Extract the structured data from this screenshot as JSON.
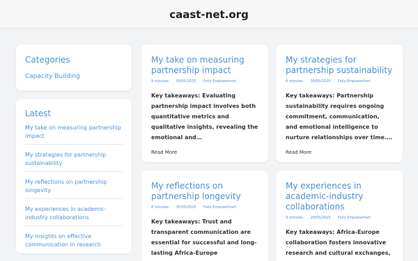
{
  "site": {
    "title": "caast-net.org"
  },
  "sidebar": {
    "categories_title": "Categories",
    "categories": [
      "Capacity Building"
    ],
    "latest_title": "Latest",
    "latest": [
      "My take on measuring partnership impact",
      "My strategies for partnership sustainability",
      "My reflections on partnership longevity",
      "My experiences in academic-industry collaborations",
      "My insights on effective communication in research"
    ]
  },
  "posts": [
    {
      "title": "My take on measuring partnership impact",
      "read_time": "9 minutes",
      "date": "30/05/2025",
      "author": "Felix Empowerhart",
      "excerpt": "Key takeaways: Evaluating partnership impact involves both quantitative metrics and qualitative insights, revealing the emotional and…",
      "read_more": "Read More"
    },
    {
      "title": "My strategies for partnership sustainability",
      "read_time": "8 minutes",
      "date": "30/05/2025",
      "author": "Felix Empowerhart",
      "excerpt": "Key takeaways: Partnership sustainability requires ongoing commitment, communication, and emotional intelligence to nurture relationships over time.…",
      "read_more": "Read More"
    },
    {
      "title": "My reflections on partnership longevity",
      "read_time": "8 minutes",
      "date": "30/05/2025",
      "author": "Felix Empowerhart",
      "excerpt": "Key takeaways: Trust and transparent communication are essential for successful and long-lasting Africa-Europe partnerships. Effective cultural…",
      "read_more": ""
    },
    {
      "title": "My experiences in academic-industry collaborations",
      "read_time": "9 minutes",
      "date": "29/05/2025",
      "author": "Felix Empowerhart",
      "excerpt": "Key takeaways: Africa-Europe collaboration fosters innovative research and cultural exchanges, highlighting the importance of",
      "read_more": ""
    }
  ]
}
